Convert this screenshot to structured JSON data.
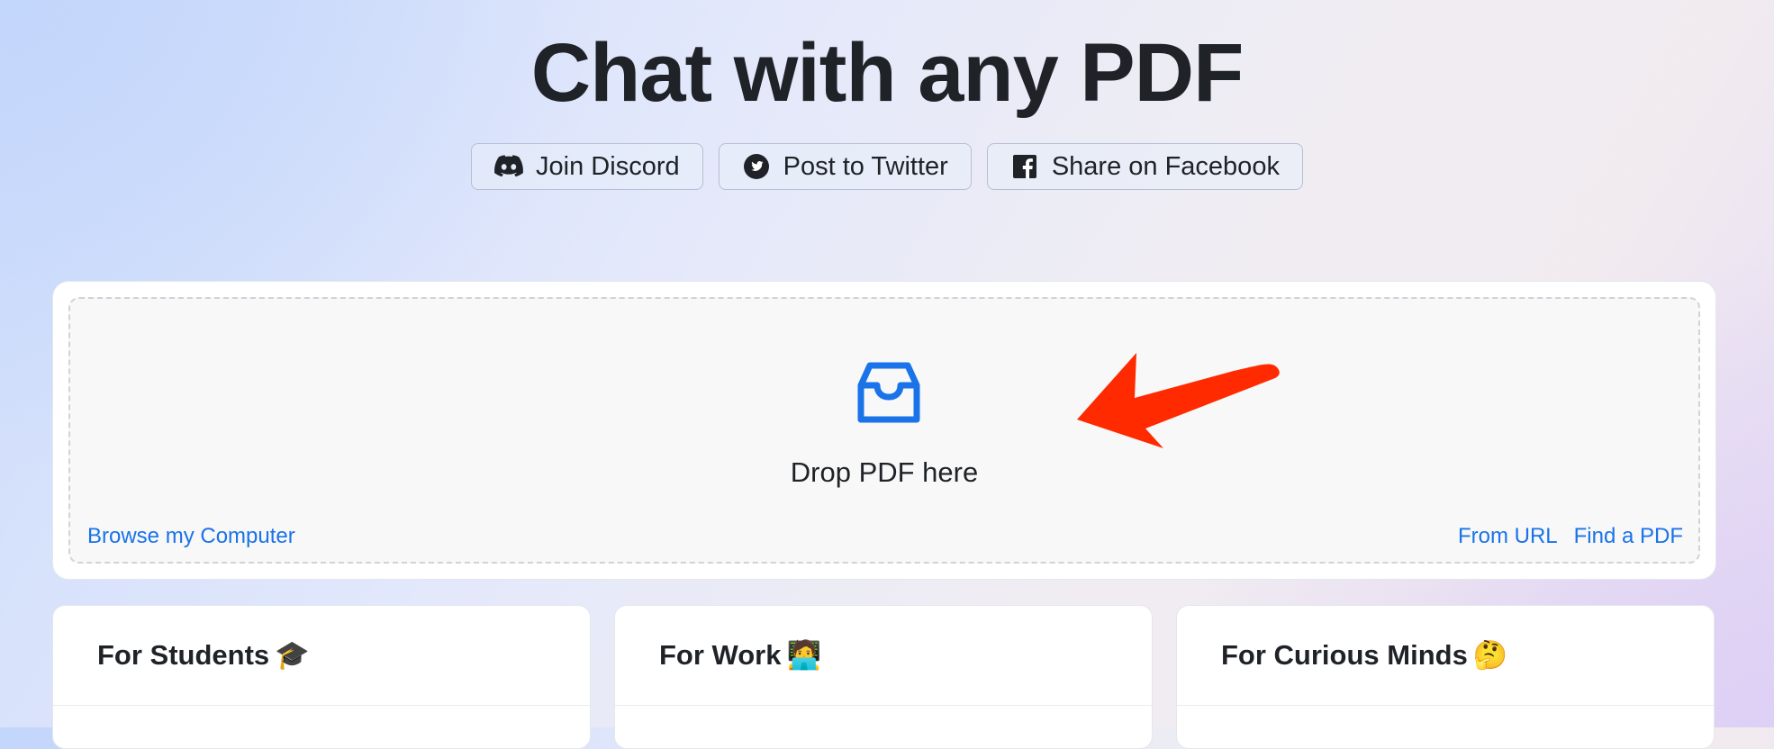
{
  "page": {
    "title": "Chat with any PDF"
  },
  "share_buttons": [
    {
      "label": "Join Discord",
      "icon": "discord-icon"
    },
    {
      "label": "Post to Twitter",
      "icon": "twitter-icon"
    },
    {
      "label": "Share on Facebook",
      "icon": "facebook-icon"
    }
  ],
  "upload": {
    "drop_label": "Drop PDF here",
    "icon": "inbox-icon",
    "browse_label": "Browse my Computer",
    "from_url_label": "From URL",
    "find_pdf_label": "Find a PDF"
  },
  "annotation": {
    "icon": "arrow-icon",
    "color": "#ff2a00"
  },
  "cards": [
    {
      "title": "For Students",
      "emoji": "🎓"
    },
    {
      "title": "For Work",
      "emoji": "🧑‍💻"
    },
    {
      "title": "For Curious Minds",
      "emoji": "🤔"
    }
  ],
  "colors": {
    "accent": "#1a73e8",
    "text": "#1f2328"
  }
}
